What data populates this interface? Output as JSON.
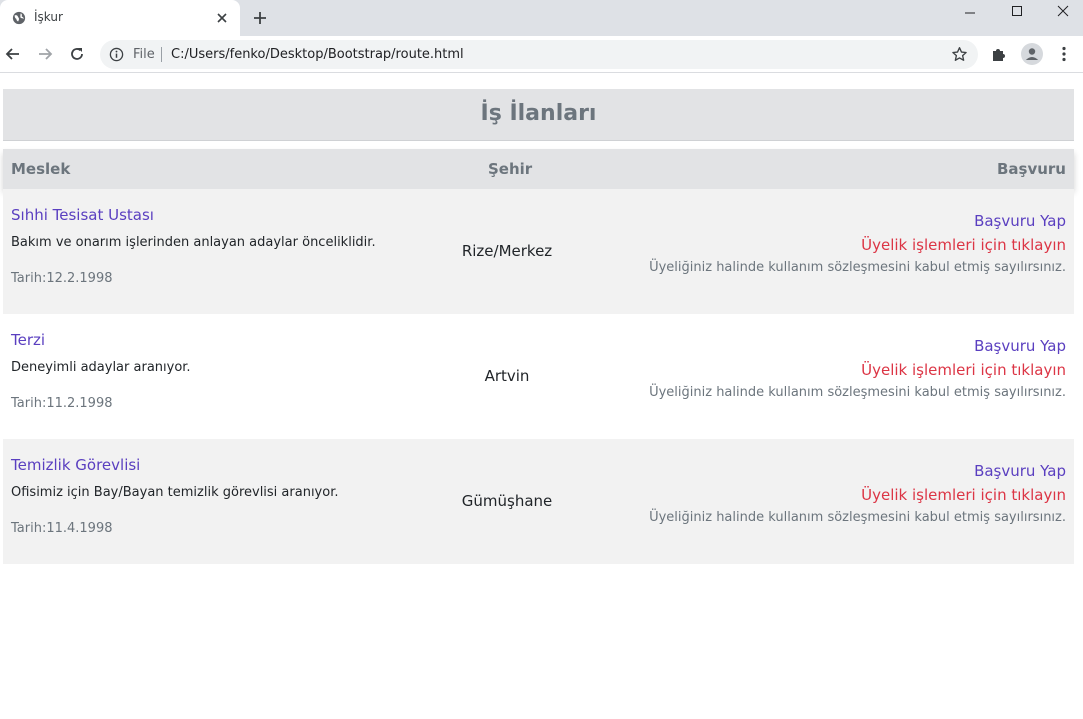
{
  "browser": {
    "tab_title": "İşkur",
    "omnibox_file": "File",
    "url": "C:/Users/fenko/Desktop/Bootstrap/route.html"
  },
  "page": {
    "title": "İş İlanları",
    "headers": {
      "meslek": "Meslek",
      "sehir": "Şehir",
      "basvuru": "Başvuru"
    },
    "rows": [
      {
        "title": "Sıhhi Tesisat Ustası",
        "description": "Bakım ve onarım işlerinden anlayan adaylar önceliklidir.",
        "date": "Tarih:12.2.1998",
        "city": "Rize/Merkez",
        "apply": "Başvuru Yap",
        "membership": "Üyelik işlemleri için tıklayın",
        "terms": "Üyeliğiniz halinde kullanım sözleşmesini kabul etmiş sayılırsınız."
      },
      {
        "title": "Terzi",
        "description": "Deneyimli adaylar aranıyor.",
        "date": "Tarih:11.2.1998",
        "city": "Artvin",
        "apply": "Başvuru Yap",
        "membership": "Üyelik işlemleri için tıklayın",
        "terms": "Üyeliğiniz halinde kullanım sözleşmesini kabul etmiş sayılırsınız."
      },
      {
        "title": "Temizlik Görevlisi",
        "description": "Ofisimiz için Bay/Bayan temizlik görevlisi aranıyor.",
        "date": "Tarih:11.4.1998",
        "city": "Gümüşhane",
        "apply": "Başvuru Yap",
        "membership": "Üyelik işlemleri için tıklayın",
        "terms": "Üyeliğiniz halinde kullanım sözleşmesini kabul etmiş sayılırsınız."
      }
    ]
  },
  "colors": {
    "link": "#5a3fc0",
    "danger": "#dc3545",
    "muted": "#6c757d",
    "header_bg": "#e2e3e5"
  }
}
